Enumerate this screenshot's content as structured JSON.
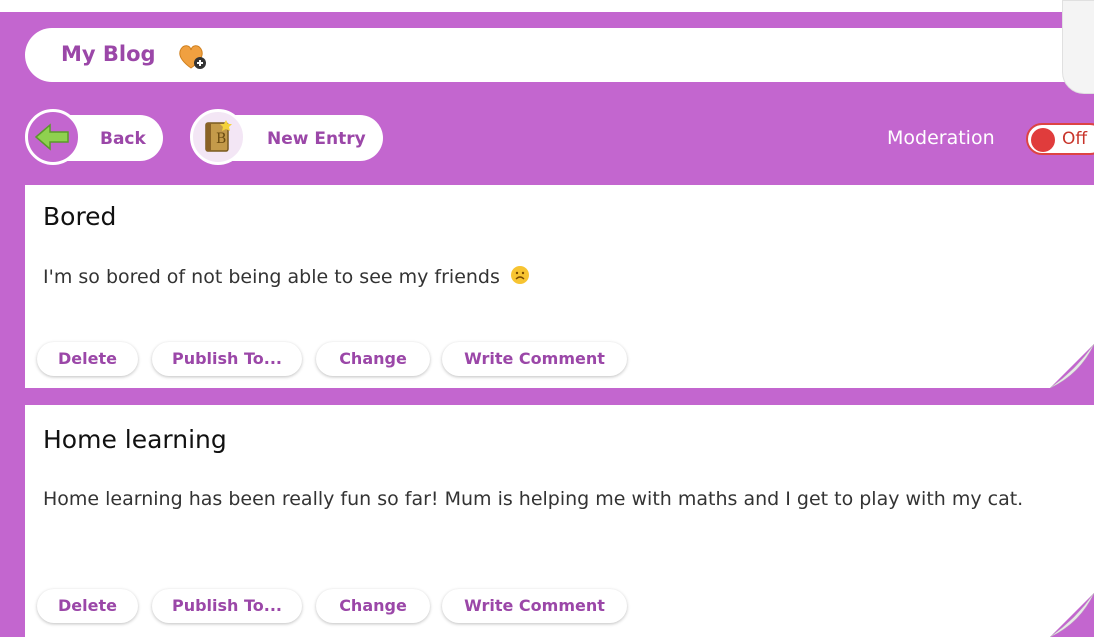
{
  "header": {
    "title": "My Blog",
    "heart_icon": "heart-plus-icon"
  },
  "toolbar": {
    "back_label": "Back",
    "back_icon": "arrow-left-icon",
    "new_entry_label": "New Entry",
    "new_entry_icon": "book-icon",
    "moderation_label": "Moderation",
    "moderation_state": "Off"
  },
  "entries": [
    {
      "title": "Bored",
      "body": "I'm so bored of not being able to see my friends",
      "emoji": "sad-face-icon",
      "actions": [
        "Delete",
        "Publish To...",
        "Change",
        "Write Comment"
      ]
    },
    {
      "title": "Home learning",
      "body": "Home learning has been really fun so far! Mum is helping me with maths and I get to play with my cat.",
      "actions": [
        "Delete",
        "Publish To...",
        "Change",
        "Write Comment"
      ]
    }
  ],
  "colors": {
    "brand_purple": "#c366cf",
    "label_purple": "#9b47a8",
    "toggle_red": "#e03c3c"
  }
}
